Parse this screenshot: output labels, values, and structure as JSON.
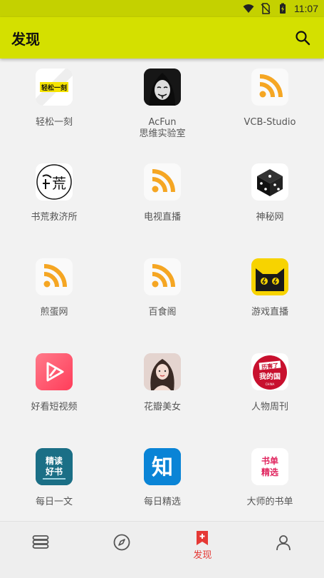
{
  "status": {
    "time": "11:07"
  },
  "appbar": {
    "title": "发现",
    "search_icon": "search-icon"
  },
  "sources": [
    {
      "label": "轻松一刻",
      "icon": "qingsong-logo"
    },
    {
      "label": "AcFun\n思维实验室",
      "icon": "masked-face-avatar"
    },
    {
      "label": "VCB-Studio",
      "icon": "rss-icon"
    },
    {
      "label": "书荒救济所",
      "icon": "shuhuang-logo"
    },
    {
      "label": "电视直播",
      "icon": "rss-icon"
    },
    {
      "label": "神秘网",
      "icon": "dice-icon"
    },
    {
      "label": "煎蛋网",
      "icon": "rss-icon"
    },
    {
      "label": "百食阁",
      "icon": "rss-icon"
    },
    {
      "label": "游戏直播",
      "icon": "cat-icon"
    },
    {
      "label": "好看短视频",
      "icon": "video-play-icon"
    },
    {
      "label": "花瓣美女",
      "icon": "photo-avatar"
    },
    {
      "label": "人物周刊",
      "icon": "renwu-logo"
    },
    {
      "label": "每日一文",
      "icon": "jingdu-logo"
    },
    {
      "label": "每日精选",
      "icon": "zhi-logo"
    },
    {
      "label": "大师的书单",
      "icon": "shudan-logo"
    }
  ],
  "nav": {
    "discover_label": "发现"
  },
  "tile_texts": {
    "shuhuang": "荒",
    "jingdu_top": "精读",
    "jingdu_bottom": "好书",
    "zhi": "知",
    "shudan_top": "书单",
    "shudan_bottom": "精选",
    "renwu_top": "历害了",
    "renwu_bottom": "我的国",
    "qingsong": "轻松一刻"
  },
  "colors": {
    "appbar": "#d4e000",
    "statusbar": "#c4d100",
    "accent": "#e53935",
    "rss": "#f5a623"
  }
}
